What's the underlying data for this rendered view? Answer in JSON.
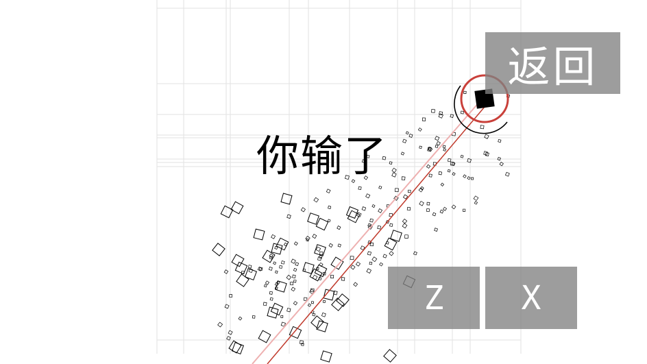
{
  "game": {
    "status_text": "你输了"
  },
  "controls": {
    "back_label": "返回",
    "z_label": "Z",
    "x_label": "X"
  },
  "colors": {
    "background": "#ffffff",
    "grid": "#dddddd",
    "target_ring": "#c0392b",
    "aim_line": "#c0392b",
    "aim_line_faint": "#e8a0a0",
    "button_bg": "#8a8a8a",
    "button_text": "#ffffff",
    "note_outline": "#000000"
  },
  "icons": {
    "player": "black-square-icon",
    "target": "ring-icon"
  }
}
